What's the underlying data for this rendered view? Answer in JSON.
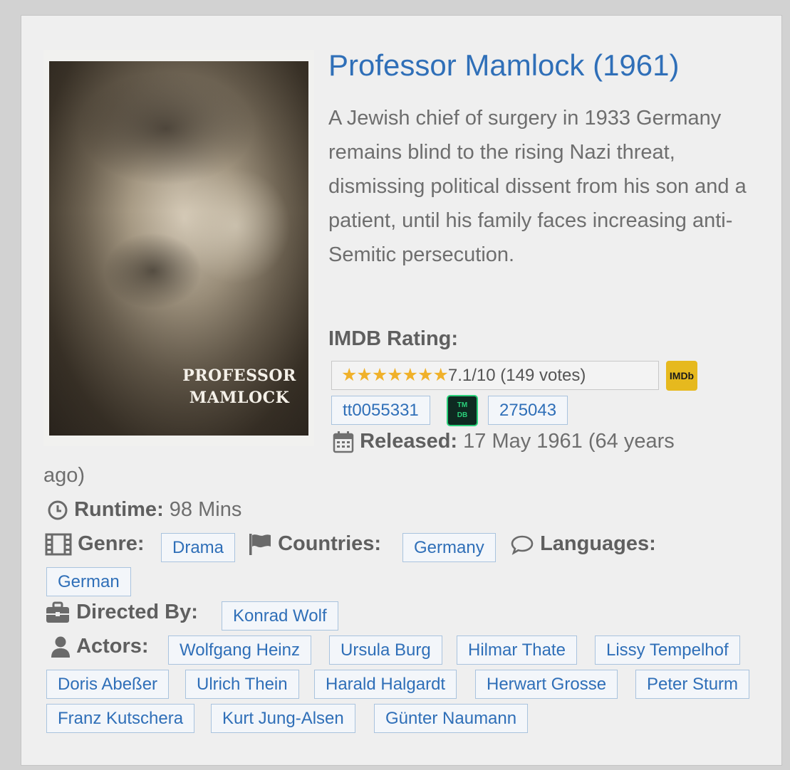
{
  "movie": {
    "title": "Professor Mamlock (1961)",
    "description": "A Jewish chief of surgery in 1933 Germany remains blind to the rising Nazi threat, dismissing political dissent from his son and a patient, until his family faces increasing anti-Semitic persecution.",
    "poster_title_line1": "PROFESSOR",
    "poster_title_line2": "MAMLOCK"
  },
  "imdb": {
    "label": "IMDB Rating:",
    "stars": "★★★★★★★",
    "rating_text": "7.1/10 (149 votes)",
    "logo_text": "IMDb",
    "id": "tt0055331"
  },
  "tmdb": {
    "logo_line1": "TM",
    "logo_line2": "DB",
    "id": "275043"
  },
  "released": {
    "label": "Released:",
    "value_line1": "17 May 1961 (64 years",
    "value_line2": "ago)"
  },
  "runtime": {
    "label": "Runtime:",
    "value": "98 Mins"
  },
  "genre": {
    "label": "Genre:",
    "items": [
      "Drama"
    ]
  },
  "countries": {
    "label": "Countries:",
    "items": [
      "Germany"
    ]
  },
  "languages": {
    "label": "Languages:",
    "items": [
      "German"
    ]
  },
  "directed": {
    "label": "Directed By:",
    "items": [
      "Konrad Wolf"
    ]
  },
  "actors": {
    "label": "Actors:",
    "items": [
      "Wolfgang Heinz",
      "Ursula Burg",
      "Hilmar Thate",
      "Lissy Tempelhof",
      "Doris Abeßer",
      "Ulrich Thein",
      "Harald Halgardt",
      "Herwart Grosse",
      "Peter Sturm",
      "Franz Kutschera",
      "Kurt Jung-Alsen",
      "Günter Naumann"
    ]
  },
  "colors": {
    "link": "#2f6fb8",
    "star": "#f0b12a",
    "imdb_yellow": "#e6b91e",
    "tmdb_green": "#2ad07a"
  }
}
